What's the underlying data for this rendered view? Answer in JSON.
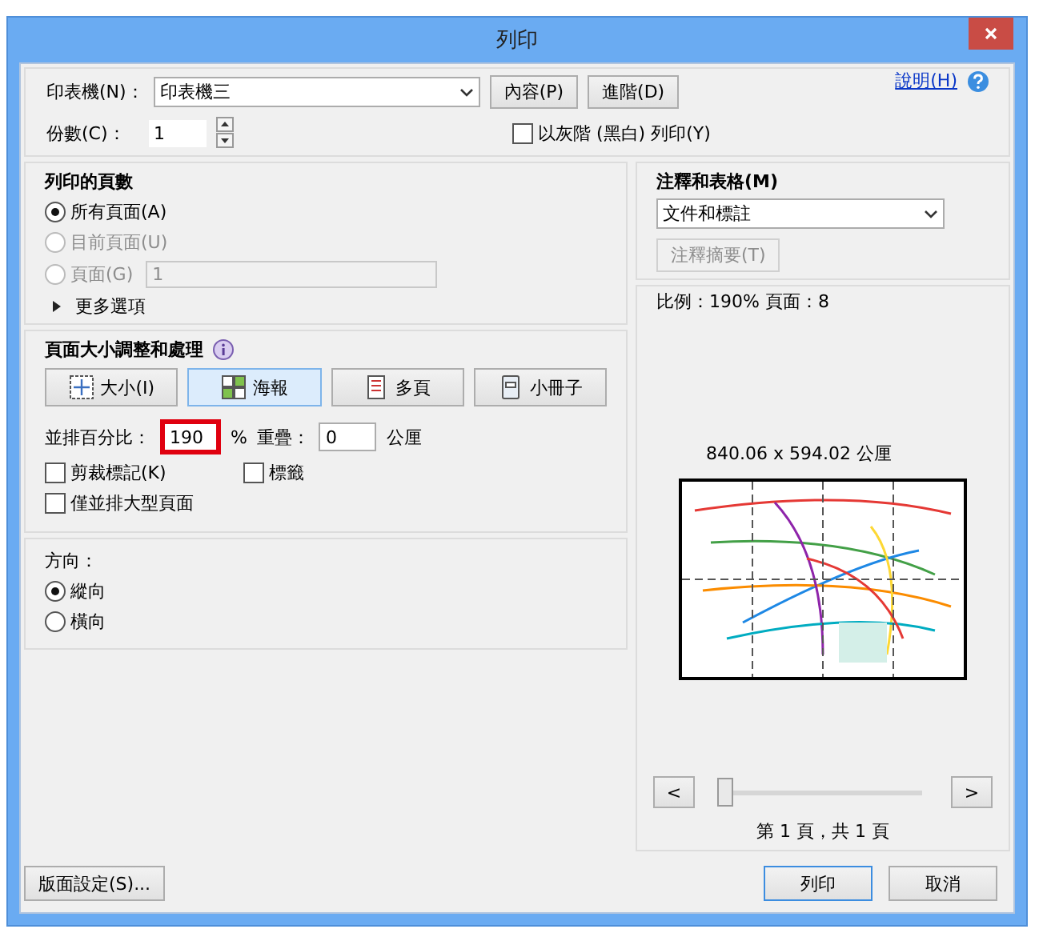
{
  "window": {
    "title": "列印"
  },
  "printer": {
    "label": "印表機(N)：",
    "value": "印表機三",
    "properties_button": "內容(P)",
    "advanced_button": "進階(D)"
  },
  "help_link": "說明(H)",
  "copies": {
    "label": "份數(C)：",
    "value": "1"
  },
  "grayscale": {
    "label": "以灰階 (黑白) 列印(Y)",
    "checked": false
  },
  "pages_to_print": {
    "title": "列印的頁數",
    "options": [
      {
        "label": "所有頁面(A)",
        "selected": true,
        "disabled": false
      },
      {
        "label": "目前頁面(U)",
        "selected": false,
        "disabled": true
      },
      {
        "label": "頁面(G)",
        "selected": false,
        "disabled": true,
        "value": "1"
      }
    ],
    "more_options": {
      "label": "更多選項",
      "expanded": false
    }
  },
  "page_sizing": {
    "title": "頁面大小調整和處理",
    "modes": [
      {
        "kind": "size",
        "label": "大小(I)",
        "selected": false
      },
      {
        "kind": "poster",
        "label": "海報",
        "selected": true
      },
      {
        "kind": "multiple",
        "label": "多頁",
        "selected": false
      },
      {
        "kind": "booklet",
        "label": "小冊子",
        "selected": false
      }
    ],
    "tile_scale": {
      "label": "並排百分比：",
      "value": "190",
      "highlighted": true,
      "suffix": "%"
    },
    "overlap": {
      "label": "重疊：",
      "value": "0",
      "unit": "公厘"
    },
    "checkboxes": [
      {
        "label": "剪裁標記(K)",
        "checked": false
      },
      {
        "label": "標籤",
        "checked": false
      },
      {
        "label": "僅並排大型頁面",
        "checked": false
      }
    ]
  },
  "orientation": {
    "title": "方向：",
    "options": [
      {
        "label": "縱向",
        "selected": true
      },
      {
        "label": "橫向",
        "selected": false
      }
    ]
  },
  "comments": {
    "title": "注釋和表格(M)",
    "value": "文件和標註",
    "summary_button": {
      "label": "注釋摘要(T)",
      "disabled": true
    }
  },
  "preview": {
    "scale_text": "比例：190% 頁面：8",
    "dimensions": "840.06 x 594.02 公厘",
    "prev_button": "<",
    "next_button": ">",
    "slider": {
      "level": 0
    },
    "page_indicator": "第 1 頁，共 1 頁"
  },
  "footer": {
    "page_setup_button": "版面設定(S)...",
    "print_button": "列印",
    "cancel_button": "取消"
  }
}
